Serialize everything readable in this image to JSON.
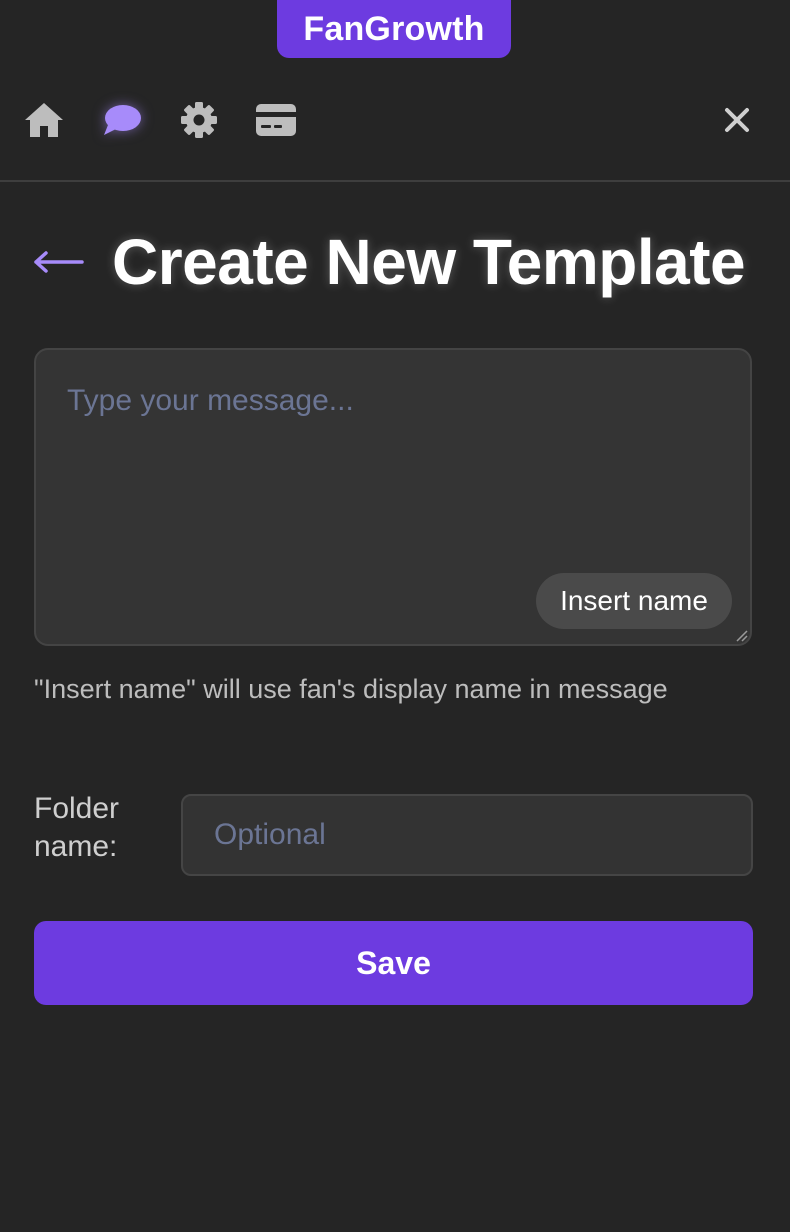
{
  "brand": {
    "name": "FanGrowth",
    "color": "#6d3be0"
  },
  "nav": {
    "icons": [
      "home-icon",
      "chat-icon",
      "gear-icon",
      "credit-card-icon",
      "close-icon"
    ],
    "active": "chat-icon",
    "active_color": "#a78bfa",
    "inactive_color": "#bdbdbd"
  },
  "header": {
    "back_icon": "arrow-left-icon",
    "title": "Create New Template"
  },
  "message": {
    "placeholder": "Type your message...",
    "insert_button": "Insert name",
    "hint": "\"Insert name\" will use fan's display name in message"
  },
  "folder": {
    "label": "Folder name:",
    "placeholder": "Optional",
    "value": ""
  },
  "actions": {
    "save": "Save"
  }
}
